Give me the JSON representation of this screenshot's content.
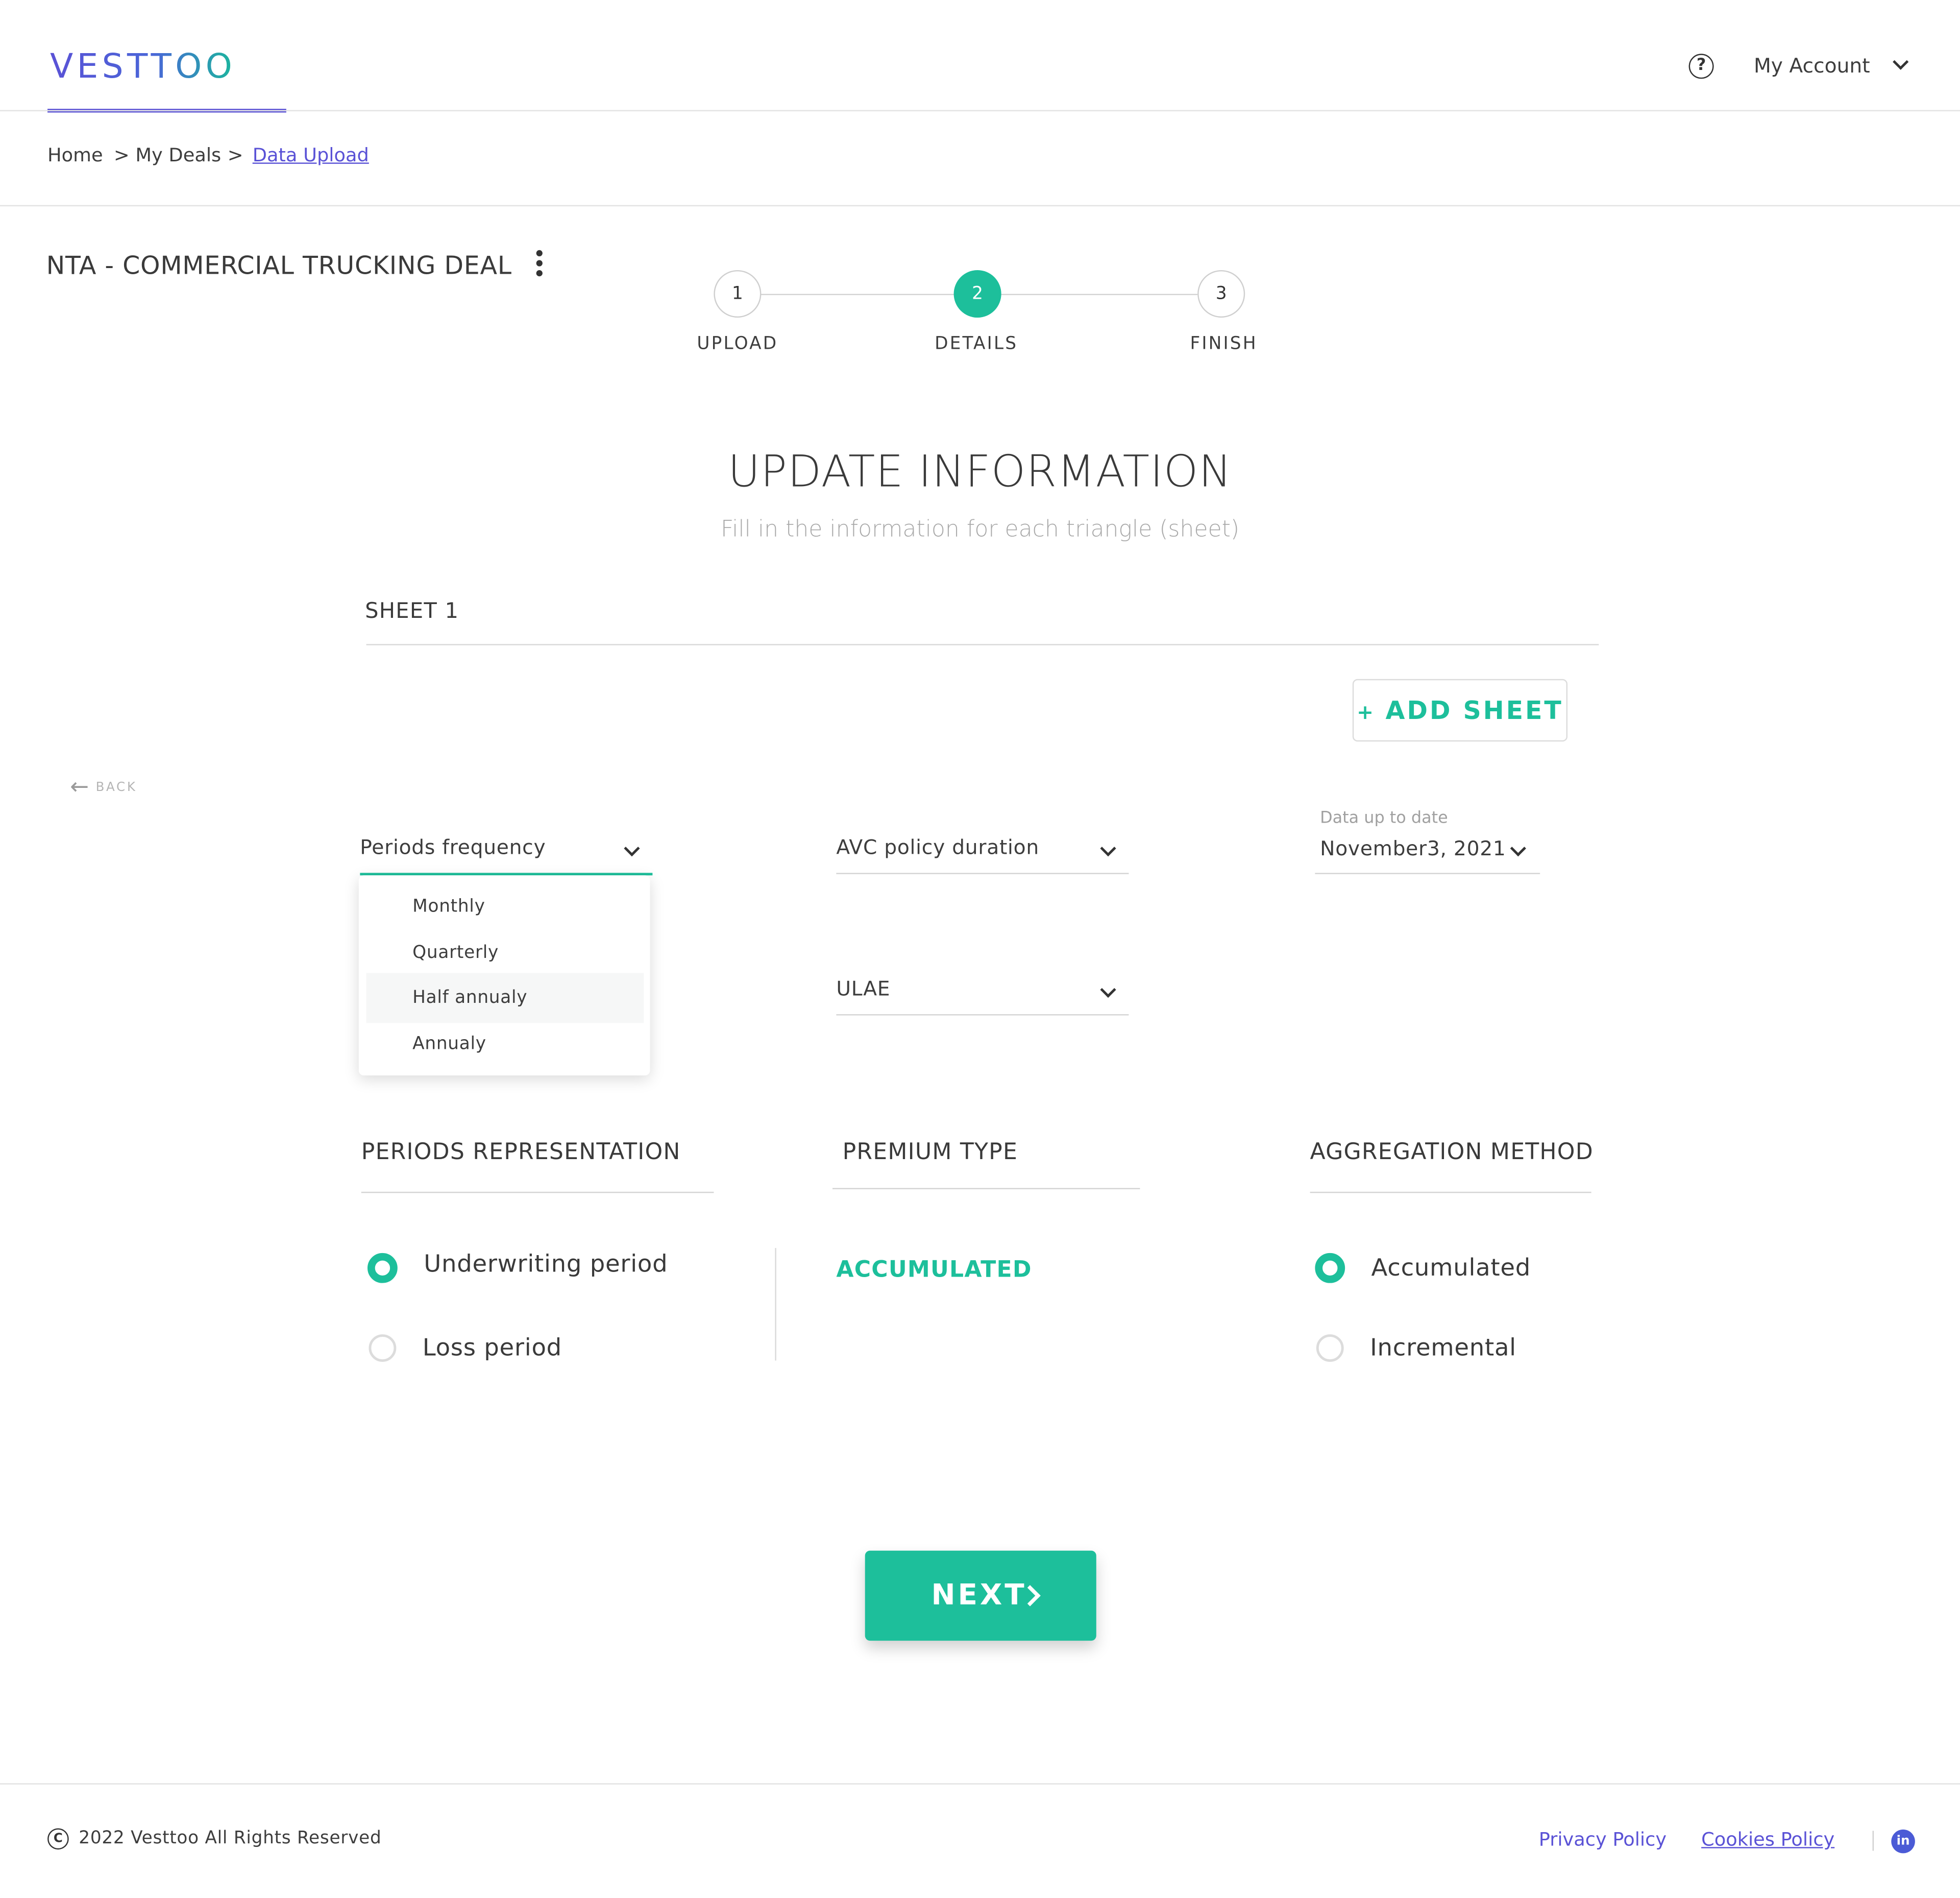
{
  "header": {
    "logo": "VESTTOO",
    "help_icon": "question-circle-icon",
    "account_label": "My Account"
  },
  "breadcrumb": {
    "items": [
      "Home",
      "> My Deals",
      ">",
      "Data Upload"
    ]
  },
  "deal": {
    "title": "NTA - COMMERCIAL TRUCKING DEAL"
  },
  "stepper": {
    "steps": [
      {
        "number": "1",
        "label": "UPLOAD"
      },
      {
        "number": "2",
        "label": "DETAILS"
      },
      {
        "number": "3",
        "label": "FINISH"
      }
    ],
    "active_step": 2
  },
  "main": {
    "title": "UPDATE INFORMATION",
    "subtitle": "Fill in the information for each triangle (sheet)",
    "sheet_label": "SHEET 1",
    "add_sheet_label": "ADD SHEET",
    "back_label": "BACK"
  },
  "fields": {
    "periods_frequency": {
      "value": "Periods frequency",
      "open": true
    },
    "avc_policy_duration": {
      "value": "AVC policy duration"
    },
    "data_up_to_date": {
      "label": "Data up to date",
      "value": "November3, 2021"
    },
    "ulae": {
      "value": "ULAE"
    }
  },
  "dropdown": {
    "options": [
      "Monthly",
      "Quarterly",
      "Half annualy",
      "Annualy"
    ],
    "highlighted": "Half annualy"
  },
  "sections": {
    "periods_representation": {
      "title": "PERIODS REPRESENTATION",
      "options": [
        "Underwriting period",
        "Loss period"
      ],
      "selected": "Underwriting period"
    },
    "premium_type": {
      "title": "PREMIUM TYPE",
      "value": "ACCUMULATED"
    },
    "aggregation_method": {
      "title": "AGGREGATION METHOD",
      "options": [
        "Accumulated",
        "Incremental"
      ],
      "selected": "Accumulated"
    }
  },
  "next_label": "NEXT",
  "footer": {
    "copyright": "2022 Vesttoo All Rights Reserved",
    "privacy": "Privacy Policy",
    "cookies": "Cookies Policy",
    "social_icon": "linkedin-icon"
  },
  "colors": {
    "accent": "#1dbf9b",
    "brand": "#5a52d6"
  }
}
